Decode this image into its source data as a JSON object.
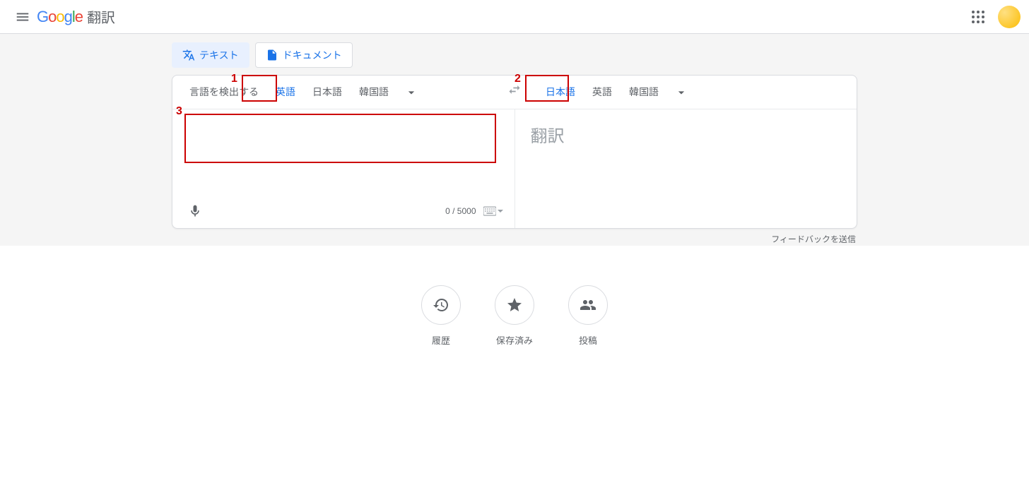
{
  "header": {
    "app_title": "翻訳"
  },
  "tabs": {
    "text": "テキスト",
    "document": "ドキュメント"
  },
  "source_langs": {
    "detect": "言語を検出する",
    "opt1": "英語",
    "opt2": "日本語",
    "opt3": "韓国語"
  },
  "target_langs": {
    "opt1": "日本語",
    "opt2": "英語",
    "opt3": "韓国語"
  },
  "panes": {
    "char_count": "0 / 5000",
    "target_placeholder": "翻訳"
  },
  "feedback": "フィードバックを送信",
  "circles": {
    "history": "履歴",
    "saved": "保存済み",
    "contribute": "投稿"
  },
  "annotations": {
    "n1": "1",
    "n2": "2",
    "n3": "3"
  }
}
